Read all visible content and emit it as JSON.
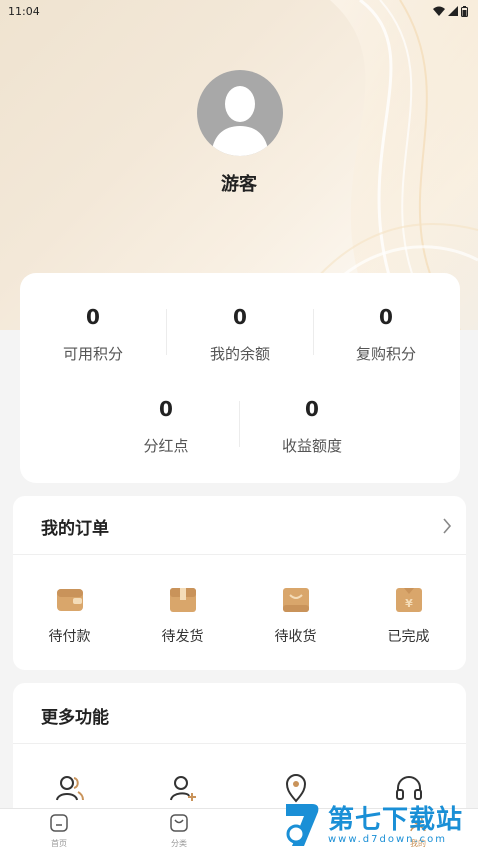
{
  "status_bar": {
    "time": "11:04",
    "icons": [
      "wifi-icon",
      "signal-icon",
      "battery-icon"
    ]
  },
  "profile": {
    "username": "游客",
    "avatar_icon": "default-avatar-icon"
  },
  "stats": [
    {
      "value": "0",
      "label": "可用积分"
    },
    {
      "value": "0",
      "label": "我的余额"
    },
    {
      "value": "0",
      "label": "复购积分"
    },
    {
      "value": "0",
      "label": "分红点"
    },
    {
      "value": "0",
      "label": "收益额度"
    }
  ],
  "orders": {
    "title": "我的订单",
    "items": [
      {
        "label": "待付款",
        "icon": "wallet-icon"
      },
      {
        "label": "待发货",
        "icon": "package-icon"
      },
      {
        "label": "待收货",
        "icon": "receive-box-icon"
      },
      {
        "label": "已完成",
        "icon": "completed-bag-icon"
      }
    ]
  },
  "more": {
    "title": "更多功能",
    "items": [
      {
        "icon": "team-icon"
      },
      {
        "icon": "add-user-icon"
      },
      {
        "icon": "location-icon"
      },
      {
        "icon": "headset-icon"
      }
    ]
  },
  "tabs": [
    {
      "label": "首页",
      "icon": "home-icon"
    },
    {
      "label": "分类",
      "icon": "category-icon"
    },
    {
      "label": "我的",
      "icon": "user-icon"
    }
  ],
  "watermark": {
    "title": "第七下载站",
    "url": "www.d7down.com"
  },
  "colors": {
    "accent": "#c9935a",
    "icon_fill": "#d9a66b",
    "watermark": "#1a8fd6"
  }
}
